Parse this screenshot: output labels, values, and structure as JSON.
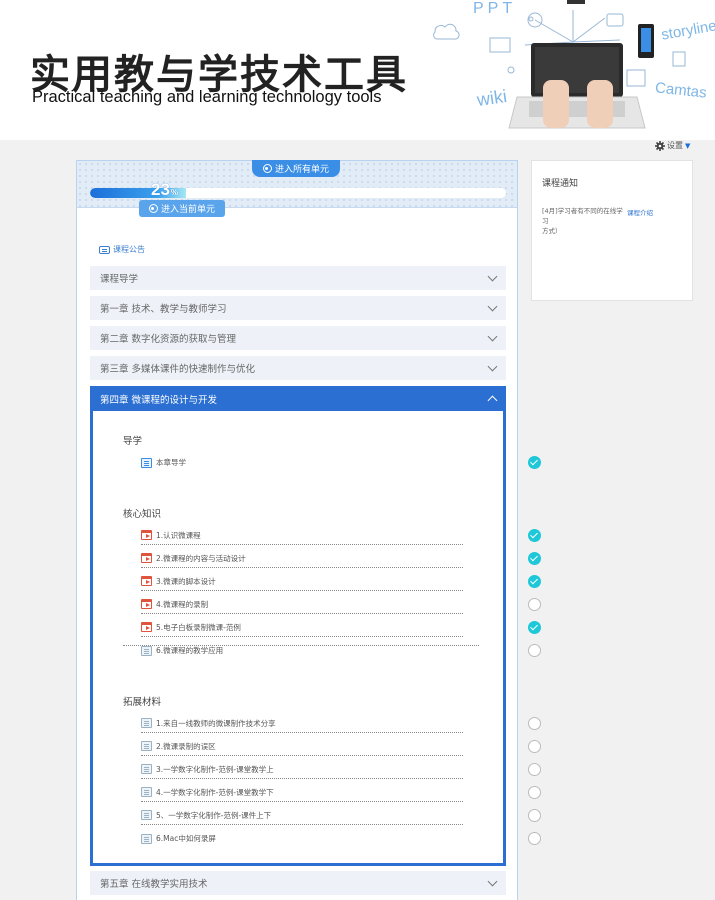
{
  "banner": {
    "title": "实用教与学技术工具",
    "subtitle": "Practical teaching and learning technology tools",
    "art_words": {
      "ppt": "PPT",
      "storyline": "storyline",
      "wiki": "wiki",
      "camtasia": "Camtas"
    }
  },
  "settings": {
    "label": "设置"
  },
  "progress": {
    "enter_all_label": "进入所有单元",
    "percent": 23,
    "percent_text": "23",
    "unit": "%",
    "enter_current_label": "进入当前单元"
  },
  "announcement": {
    "label": "课程公告"
  },
  "chapters": [
    {
      "label": "课程导学"
    },
    {
      "label": "第一章 技术、教学与教师学习"
    },
    {
      "label": "第二章 数字化资源的获取与管理"
    },
    {
      "label": "第三章 多媒体课件的快速制作与优化"
    },
    {
      "label": "第四章 微课程的设计与开发"
    },
    {
      "label": "第五章 在线教学实用技术"
    }
  ],
  "sections": {
    "guide": {
      "title": "导学",
      "items": [
        {
          "label": "本章导学",
          "status": "done"
        }
      ]
    },
    "core": {
      "title": "核心知识",
      "items": [
        {
          "label": "1.认识微课程",
          "status": "done"
        },
        {
          "label": "2.微课程的内容与活动设计",
          "status": "done"
        },
        {
          "label": "3.微课的脚本设计",
          "status": "done"
        },
        {
          "label": "4.微课程的录制",
          "status": "todo"
        },
        {
          "label": "5.电子白板录制微课-范例",
          "status": "done"
        },
        {
          "label": "6.微课程的教学应用",
          "status": "todo"
        }
      ]
    },
    "extended": {
      "title": "拓展材料",
      "items": [
        {
          "label": "1.来自一线教师的微课制作技术分享",
          "status": "todo"
        },
        {
          "label": "2.微课录制的误区",
          "status": "todo"
        },
        {
          "label": "3.一学数字化制作-范例-课堂教学上",
          "status": "todo"
        },
        {
          "label": "4.一学数字化制作-范例-课堂教学下",
          "status": "todo"
        },
        {
          "label": "5、一学数字化制作-范例-课件上下",
          "status": "todo"
        },
        {
          "label": "6.Mac中如何录屏",
          "status": "todo"
        }
      ]
    }
  },
  "notice": {
    "title": "课程通知",
    "text": "[4月]学习者有不同的在线学习",
    "text_cont": "方式）",
    "link": "课程介绍"
  },
  "colors": {
    "accent": "#2a6fd1",
    "done": "#1ec8d8",
    "video_icon": "#e0533c"
  }
}
